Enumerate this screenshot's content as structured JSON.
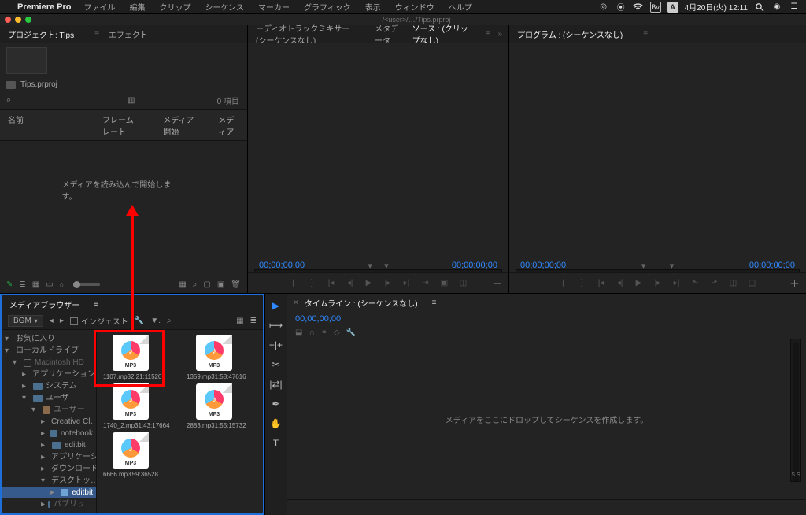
{
  "menubar": {
    "app_name": "Premiere Pro",
    "items": [
      "ファイル",
      "編集",
      "クリップ",
      "シーケンス",
      "マーカー",
      "グラフィック",
      "表示",
      "ウィンドウ",
      "ヘルプ"
    ],
    "datetime": "4月20日(火) 12:11"
  },
  "titlebar": {
    "path": "/<user>/…/Tips.prproj"
  },
  "project": {
    "tab_project": "プロジェクト: Tips",
    "tab_effects": "エフェクト",
    "filename": "Tips.prproj",
    "item_count_label": "0 項目",
    "columns": {
      "name": "名前",
      "framerate": "フレームレート",
      "media_start": "メディア開始",
      "media": "メディア"
    },
    "empty_msg": "メディアを読み込んで開始します。"
  },
  "source": {
    "tab_mixer": "ーディオトラックミキサー : (シーケンスなし)",
    "tab_metadata": "メタデータ",
    "tab_source": "ソース : (クリップなし)",
    "tc_left": "00;00;00;00",
    "tc_right": "00;00;00;00"
  },
  "program": {
    "tab": "プログラム : (シーケンスなし)",
    "tc_left": "00;00;00;00",
    "tc_right": "00;00;00;00"
  },
  "media": {
    "tab": "メディアブラウザー",
    "dropdown": "BGM",
    "ingest_label": "インジェスト",
    "tree": {
      "fav": "お気に入り",
      "local": "ローカルドライブ",
      "hd": "Macintosh HD",
      "app": "アプリケーション",
      "sys": "システム",
      "users": "ユーザ",
      "user": "ユーザー",
      "cc": "Creative Cl…",
      "nb": "notebook",
      "ed": "editbit",
      "apps": "アプリケーシ…",
      "dl": "ダウンロード",
      "desk": "デスクトッ…",
      "edb": "editbit",
      "pub": "パブリッ…"
    },
    "files": [
      {
        "name": "1107.mp3",
        "dur": "2:21:11520"
      },
      {
        "name": "1359.mp3",
        "dur": "1:58:47616"
      },
      {
        "name": "1740_2.mp3",
        "dur": "1:43:17664"
      },
      {
        "name": "2883.mp3",
        "dur": "1:55:15732"
      },
      {
        "name": "6666.mp3",
        "dur": "59:36528"
      }
    ],
    "format": "MP3"
  },
  "timeline": {
    "tab": "タイムライン : (シーケンスなし)",
    "tc": "00;00;00;00",
    "drop_msg": "メディアをここにドロップしてシーケンスを作成します。",
    "meter_label": "S S"
  }
}
